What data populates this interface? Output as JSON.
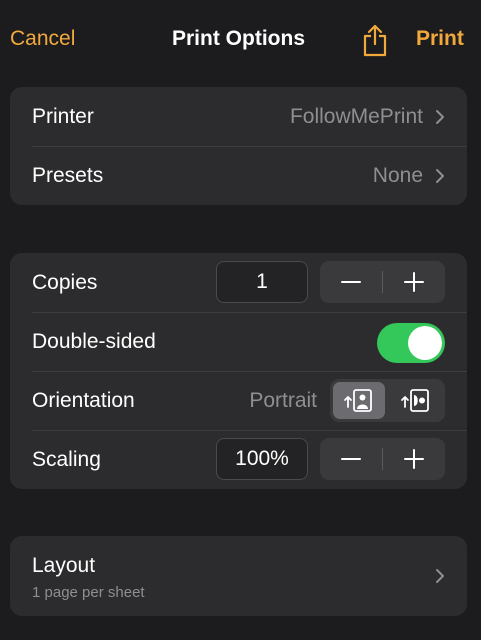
{
  "nav": {
    "cancel_label": "Cancel",
    "title": "Print Options",
    "share_icon": "share-icon",
    "print_label": "Print"
  },
  "printer_group": {
    "printer": {
      "label": "Printer",
      "value": "FollowMePrint"
    },
    "presets": {
      "label": "Presets",
      "value": "None"
    }
  },
  "options_group": {
    "copies": {
      "label": "Copies",
      "value": "1"
    },
    "double_sided": {
      "label": "Double-sided",
      "enabled": true
    },
    "orientation": {
      "label": "Orientation",
      "value": "Portrait",
      "options": [
        "portrait",
        "landscape"
      ],
      "selected": "portrait"
    },
    "scaling": {
      "label": "Scaling",
      "value": "100%"
    }
  },
  "layout_group": {
    "layout": {
      "label": "Layout",
      "subtitle": "1 page per sheet"
    }
  },
  "colors": {
    "accent": "#f2a93b",
    "toggle_on": "#34c759",
    "background": "#1c1c1e",
    "group": "#2c2c2e"
  }
}
